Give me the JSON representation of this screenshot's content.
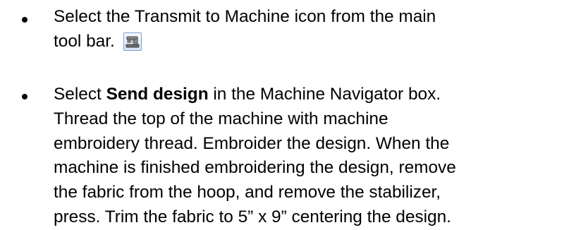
{
  "items": [
    {
      "line1": "Select the Transmit to Machine icon from the main",
      "line2": "tool bar.",
      "icon": "sewing-machine-icon"
    },
    {
      "line1_pre": "Select ",
      "line1_bold": "Send design",
      "line1_post": " in the Machine Navigator box.",
      "line2": "Thread the top of the machine with machine",
      "line3": "embroidery thread.  Embroider the design. When the",
      "line4": "machine is finished embroidering the design, remove",
      "line5": "the fabric from the hoop, and remove the stabilizer,",
      "line6": "press. Trim the fabric to 5” x 9” centering the design."
    }
  ]
}
